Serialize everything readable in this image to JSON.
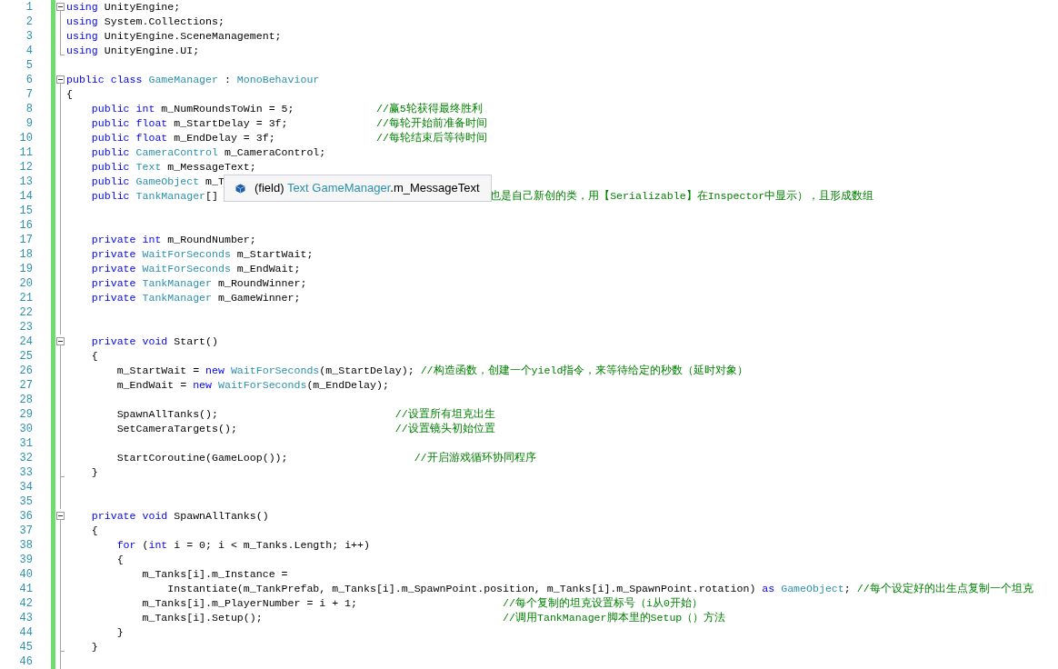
{
  "lines": [
    {
      "number": "1",
      "fold": true,
      "tokens": [
        {
          "text": "using ",
          "kind": "keyword"
        },
        {
          "text": "UnityEngine;",
          "kind": "plain"
        }
      ]
    },
    {
      "number": "2",
      "tokens": [
        {
          "text": "using ",
          "kind": "keyword"
        },
        {
          "text": "System.Collections;",
          "kind": "plain"
        }
      ]
    },
    {
      "number": "3",
      "tokens": [
        {
          "text": "using ",
          "kind": "keyword"
        },
        {
          "text": "UnityEngine.SceneManagement;",
          "kind": "plain"
        }
      ]
    },
    {
      "number": "4",
      "fold_end": true,
      "tokens": [
        {
          "text": "using ",
          "kind": "keyword"
        },
        {
          "text": "UnityEngine.UI;",
          "kind": "plain"
        }
      ]
    },
    {
      "number": "5"
    },
    {
      "number": "6",
      "fold": true,
      "tokens": [
        {
          "text": "public class ",
          "kind": "keyword"
        },
        {
          "text": "GameManager",
          "kind": "type"
        },
        {
          "text": " : ",
          "kind": "plain"
        },
        {
          "text": "MonoBehaviour",
          "kind": "type"
        }
      ]
    },
    {
      "number": "7",
      "tokens": [
        {
          "text": "{",
          "kind": "plain"
        }
      ]
    },
    {
      "number": "8",
      "tokens": [
        {
          "text": "    public int",
          "kind": "keyword"
        },
        {
          "text": " m_NumRoundsToWin = 5;             ",
          "kind": "plain"
        },
        {
          "text": "//赢5轮获得最终胜利",
          "kind": "comment"
        }
      ]
    },
    {
      "number": "9",
      "tokens": [
        {
          "text": "    public float",
          "kind": "keyword"
        },
        {
          "text": " m_StartDelay = 3f;              ",
          "kind": "plain"
        },
        {
          "text": "//每轮开始前准备时间",
          "kind": "comment"
        }
      ]
    },
    {
      "number": "10",
      "tokens": [
        {
          "text": "    public float",
          "kind": "keyword"
        },
        {
          "text": " m_EndDelay = 3f;                ",
          "kind": "plain"
        },
        {
          "text": "//每轮结束后等待时间",
          "kind": "comment"
        }
      ]
    },
    {
      "number": "11",
      "tokens": [
        {
          "text": "    public ",
          "kind": "keyword"
        },
        {
          "text": "CameraControl",
          "kind": "type"
        },
        {
          "text": " m_CameraControl;",
          "kind": "plain"
        }
      ]
    },
    {
      "number": "12",
      "tokens": [
        {
          "text": "    public ",
          "kind": "keyword"
        },
        {
          "text": "Text",
          "kind": "type"
        },
        {
          "text": " m_MessageText;",
          "kind": "plain"
        }
      ]
    },
    {
      "number": "13",
      "tokens": [
        {
          "text": "    public ",
          "kind": "keyword"
        },
        {
          "text": "GameObject",
          "kind": "type"
        },
        {
          "text": " m_T",
          "kind": "plain"
        }
      ]
    },
    {
      "number": "14",
      "tokens": [
        {
          "text": "    public ",
          "kind": "keyword"
        },
        {
          "text": "TankManager",
          "kind": "type"
        },
        {
          "text": "[]                                           ",
          "kind": "plain"
        },
        {
          "text": "也是自己新创的类，用【Serializable】在Inspector中显示），且形成数组",
          "kind": "comment"
        }
      ]
    },
    {
      "number": "15"
    },
    {
      "number": "16"
    },
    {
      "number": "17",
      "tokens": [
        {
          "text": "    private int",
          "kind": "keyword"
        },
        {
          "text": " m_RoundNumber;",
          "kind": "plain"
        }
      ]
    },
    {
      "number": "18",
      "tokens": [
        {
          "text": "    private ",
          "kind": "keyword"
        },
        {
          "text": "WaitForSeconds",
          "kind": "type"
        },
        {
          "text": " m_StartWait;",
          "kind": "plain"
        }
      ]
    },
    {
      "number": "19",
      "tokens": [
        {
          "text": "    private ",
          "kind": "keyword"
        },
        {
          "text": "WaitForSeconds",
          "kind": "type"
        },
        {
          "text": " m_EndWait;",
          "kind": "plain"
        }
      ]
    },
    {
      "number": "20",
      "tokens": [
        {
          "text": "    private ",
          "kind": "keyword"
        },
        {
          "text": "TankManager",
          "kind": "type"
        },
        {
          "text": " m_RoundWinner;",
          "kind": "plain"
        }
      ]
    },
    {
      "number": "21",
      "tokens": [
        {
          "text": "    private ",
          "kind": "keyword"
        },
        {
          "text": "TankManager",
          "kind": "type"
        },
        {
          "text": " m_GameWinner;",
          "kind": "plain"
        }
      ]
    },
    {
      "number": "22"
    },
    {
      "number": "23"
    },
    {
      "number": "24",
      "fold": true,
      "tokens": [
        {
          "text": "    private void",
          "kind": "keyword"
        },
        {
          "text": " Start()",
          "kind": "plain"
        }
      ]
    },
    {
      "number": "25",
      "tokens": [
        {
          "text": "    {",
          "kind": "plain"
        }
      ]
    },
    {
      "number": "26",
      "tokens": [
        {
          "text": "        m_StartWait = ",
          "kind": "plain"
        },
        {
          "text": "new ",
          "kind": "keyword"
        },
        {
          "text": "WaitForSeconds",
          "kind": "type"
        },
        {
          "text": "(m_StartDelay); ",
          "kind": "plain"
        },
        {
          "text": "//构造函数，创建一个yield指令，来等待给定的秒数（延时对象）",
          "kind": "comment"
        }
      ]
    },
    {
      "number": "27",
      "tokens": [
        {
          "text": "        m_EndWait = ",
          "kind": "plain"
        },
        {
          "text": "new ",
          "kind": "keyword"
        },
        {
          "text": "WaitForSeconds",
          "kind": "type"
        },
        {
          "text": "(m_EndDelay);",
          "kind": "plain"
        }
      ]
    },
    {
      "number": "28"
    },
    {
      "number": "29",
      "tokens": [
        {
          "text": "        SpawnAllTanks();                            ",
          "kind": "plain"
        },
        {
          "text": "//设置所有坦克出生",
          "kind": "comment"
        }
      ]
    },
    {
      "number": "30",
      "tokens": [
        {
          "text": "        SetCameraTargets();                         ",
          "kind": "plain"
        },
        {
          "text": "//设置镜头初始位置",
          "kind": "comment"
        }
      ]
    },
    {
      "number": "31"
    },
    {
      "number": "32",
      "tokens": [
        {
          "text": "        StartCoroutine(GameLoop());                    ",
          "kind": "plain"
        },
        {
          "text": "//开启游戏循环协同程序",
          "kind": "comment"
        }
      ]
    },
    {
      "number": "33",
      "fold_end": true,
      "tokens": [
        {
          "text": "    }",
          "kind": "plain"
        }
      ]
    },
    {
      "number": "34"
    },
    {
      "number": "35"
    },
    {
      "number": "36",
      "fold": true,
      "tokens": [
        {
          "text": "    private void",
          "kind": "keyword"
        },
        {
          "text": " SpawnAllTanks()",
          "kind": "plain"
        }
      ]
    },
    {
      "number": "37",
      "tokens": [
        {
          "text": "    {",
          "kind": "plain"
        }
      ]
    },
    {
      "number": "38",
      "tokens": [
        {
          "text": "        for",
          "kind": "keyword"
        },
        {
          "text": " (",
          "kind": "plain"
        },
        {
          "text": "int",
          "kind": "keyword"
        },
        {
          "text": " i = 0; i < m_Tanks.Length; i++)",
          "kind": "plain"
        }
      ]
    },
    {
      "number": "39",
      "tokens": [
        {
          "text": "        {",
          "kind": "plain"
        }
      ]
    },
    {
      "number": "40",
      "tokens": [
        {
          "text": "            m_Tanks[i].m_Instance =",
          "kind": "plain"
        }
      ]
    },
    {
      "number": "41",
      "tokens": [
        {
          "text": "                Instantiate(m_TankPrefab, m_Tanks[i].m_SpawnPoint.position, m_Tanks[i].m_SpawnPoint.rotation) ",
          "kind": "plain"
        },
        {
          "text": "as ",
          "kind": "keyword"
        },
        {
          "text": "GameObject",
          "kind": "type"
        },
        {
          "text": "; ",
          "kind": "plain"
        },
        {
          "text": "//每个设定好的出生点复制一个坦克",
          "kind": "comment"
        }
      ]
    },
    {
      "number": "42",
      "tokens": [
        {
          "text": "            m_Tanks[i].m_PlayerNumber = i + 1;                       ",
          "kind": "plain"
        },
        {
          "text": "//每个复制的坦克设置标号（i从0开始）",
          "kind": "comment"
        }
      ]
    },
    {
      "number": "43",
      "tokens": [
        {
          "text": "            m_Tanks[i].Setup();                                      ",
          "kind": "plain"
        },
        {
          "text": "//调用TankManager脚本里的Setup（）方法",
          "kind": "comment"
        }
      ]
    },
    {
      "number": "44",
      "tokens": [
        {
          "text": "        }",
          "kind": "plain"
        }
      ]
    },
    {
      "number": "45",
      "fold_end": true,
      "tokens": [
        {
          "text": "    }",
          "kind": "plain"
        }
      ]
    },
    {
      "number": "46"
    }
  ],
  "tooltip": {
    "tokens": [
      {
        "text": "(field) ",
        "kind": "plain"
      },
      {
        "text": "Text GameManager",
        "kind": "type"
      },
      {
        "text": ".m_MessageText",
        "kind": "plain"
      }
    ]
  }
}
